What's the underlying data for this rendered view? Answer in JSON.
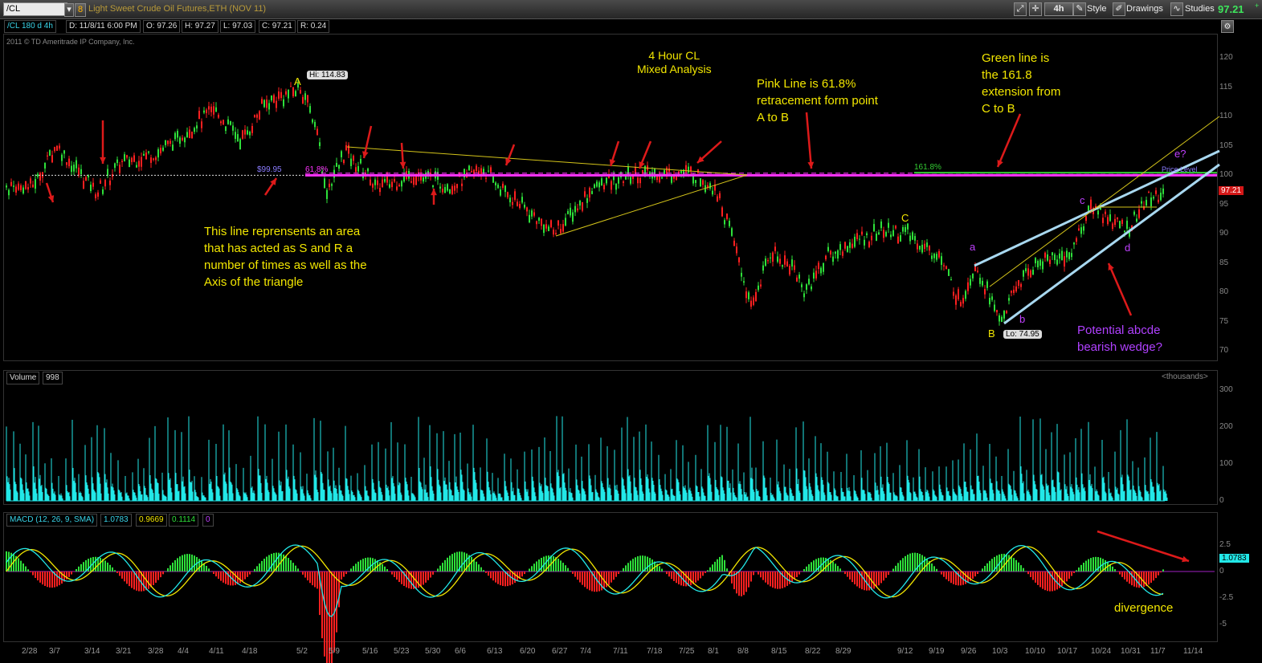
{
  "toolbar": {
    "symbol": "/CL",
    "linked_number": "8",
    "description": "Light Sweet Crude Oil Futures,ETH (NOV 11)",
    "timeframe": "4h",
    "style_label": "Style",
    "drawings_label": "Drawings",
    "studies_label": "Studies",
    "last_price": "97.21",
    "change_fragment": "+"
  },
  "infobar": {
    "study_label": "/CL 180 d 4h",
    "date": "D: 11/8/11 6:00 PM",
    "open": "O: 97.26",
    "high": "H: 97.27",
    "low": "L: 97.03",
    "close": "C: 97.21",
    "range": "R: 0.24"
  },
  "copyright": "2011 © TD Ameritrade IP Company, Inc.",
  "price_axis": [
    "120",
    "115",
    "110",
    "105",
    "100",
    "95",
    "90",
    "85",
    "80",
    "75",
    "70"
  ],
  "volume_axis": [
    "300",
    "200",
    "100",
    "0"
  ],
  "macd_axis": [
    "2.5",
    "0",
    "-2.5",
    "-5"
  ],
  "x_axis": [
    "2/28",
    "3/7",
    "3/14",
    "3/21",
    "3/28",
    "4/4",
    "4/11",
    "4/18",
    "5/2",
    "5/9",
    "5/16",
    "5/23",
    "5/30",
    "6/6",
    "6/13",
    "6/20",
    "6/27",
    "7/4",
    "7/11",
    "7/18",
    "7/25",
    "8/1",
    "8/8",
    "8/15",
    "8/22",
    "8/29",
    "9/12",
    "9/19",
    "9/26",
    "10/3",
    "10/10",
    "10/17",
    "10/24",
    "10/31",
    "11/7",
    "11/14"
  ],
  "price_badges": {
    "hi": "Hi: 114.83",
    "lo": "Lo: 74.95",
    "level_label": "$99.95",
    "fib618": "61.8%",
    "fib1618": "161.8%",
    "last_price_tag": "97.21",
    "price_level_tag": "Price Level"
  },
  "wave_labels": {
    "A": "A",
    "B": "B",
    "C": "C",
    "a": "a",
    "b": "b",
    "c": "c",
    "d": "d",
    "e": "e?"
  },
  "annotations": {
    "title_line1": "4 Hour CL",
    "title_line2": "Mixed Analysis",
    "pink_line1": "Pink Line is 61.8%",
    "pink_line2": "retracement form point",
    "pink_line3": "A to B",
    "green_line1": "Green line is",
    "green_line2": "the 161.8",
    "green_line3": "extension from",
    "green_line4": "C to B",
    "axis_line1": "This line reprensents an area",
    "axis_line2": "that has acted as S and R a",
    "axis_line3": "number of times as well as the",
    "axis_line4": "Axis of the triangle",
    "wedge_line1": "Potential abcde",
    "wedge_line2": "bearish wedge?",
    "divergence": "divergence"
  },
  "volume": {
    "label": "Volume",
    "value": "998",
    "unit": "<thousands>"
  },
  "macd": {
    "label": "MACD (12, 26, 9, SMA)",
    "value": "1.0783",
    "avg": "0.9669",
    "diff": "0.1114",
    "extra": "0",
    "last_tag": "1.0783"
  },
  "colors": {
    "candle_up": "#2ee03a",
    "candle_down": "#ff2020",
    "volume": "#22e8e8",
    "macd_line": "#22e8e8",
    "macd_avg": "#f2e600",
    "fib_pink": "#ff33ff",
    "fib_green": "#33cc33",
    "trend": "#d4c41a",
    "wedge": "#a8d8f0",
    "arrow": "#dd1a1a"
  },
  "chart_data": {
    "type": "candlestick",
    "price_ylim": [
      70,
      120
    ],
    "volume_ylim": [
      0,
      300
    ],
    "macd_ylim": [
      -6,
      4
    ],
    "key_points": [
      {
        "label": "A",
        "date": "4/29",
        "price": 114.83
      },
      {
        "label": "B",
        "date": "10/4",
        "price": 74.95
      },
      {
        "label": "C",
        "date": "9/12",
        "price": 90.5
      }
    ],
    "levels": [
      {
        "name": "61.8%",
        "price": 99.95
      },
      {
        "name": "161.8%",
        "price": 100.1
      }
    ],
    "last_close": 97.21
  }
}
